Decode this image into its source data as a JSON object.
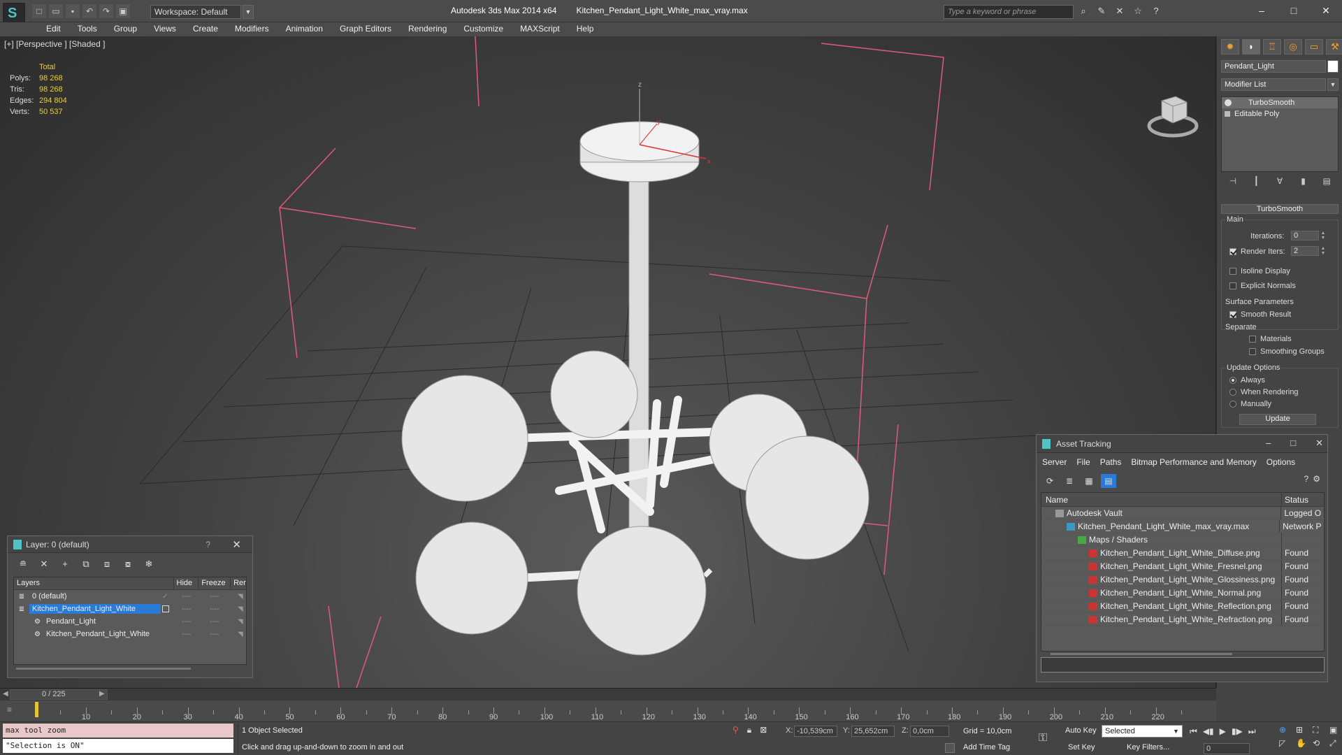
{
  "app": {
    "title_product": "Autodesk 3ds Max  2014 x64",
    "title_file": "Kitchen_Pendant_Light_White_max_vray.max",
    "workspace": "Workspace: Default",
    "search_placeholder": "Type a keyword or phrase",
    "colors": {
      "accent": "#2a7ad6",
      "stat_yellow": "#e6d23a",
      "playhead": "#e6c43a",
      "grid_pink": "#e05a7a"
    }
  },
  "menu": [
    "Edit",
    "Tools",
    "Group",
    "Views",
    "Create",
    "Modifiers",
    "Animation",
    "Graph Editors",
    "Rendering",
    "Customize",
    "MAXScript",
    "Help"
  ],
  "viewport": {
    "label": "[+] [Perspective ] [Shaded ]",
    "stats": {
      "total_label": "Total",
      "rows": [
        {
          "k": "Polys:",
          "v": "98 268"
        },
        {
          "k": "Tris:",
          "v": "98 268"
        },
        {
          "k": "Edges:",
          "v": "294 804"
        },
        {
          "k": "Verts:",
          "v": "50 537"
        }
      ]
    },
    "axis": {
      "x": "x",
      "y": "y",
      "z": "z"
    }
  },
  "command_panel": {
    "object_name": "Pendant_Light",
    "modifier_list": "Modifier List",
    "stack": [
      "TurboSmooth",
      "Editable Poly"
    ],
    "rollout_title": "TurboSmooth",
    "main_label": "Main",
    "iterations_label": "Iterations:",
    "iterations_value": "0",
    "render_iters_label": "Render Iters:",
    "render_iters_value": "2",
    "isoline": "Isoline Display",
    "explicit": "Explicit Normals",
    "surface_params": "Surface Parameters",
    "smooth_result": "Smooth Result",
    "separate": "Separate",
    "materials": "Materials",
    "smoothing_groups": "Smoothing Groups",
    "update_options": "Update Options",
    "always": "Always",
    "when_rendering": "When Rendering",
    "manually": "Manually",
    "update_btn": "Update"
  },
  "layer_window": {
    "title": "Layer: 0 (default)",
    "help": "?",
    "headers": {
      "layers": "Layers",
      "hide": "Hide",
      "freeze": "Freeze",
      "render": "Rend"
    },
    "rows": [
      {
        "name": "0 (default)",
        "level": 0
      },
      {
        "name": "Kitchen_Pendant_Light_White",
        "level": 0
      },
      {
        "name": "Pendant_Light",
        "level": 1
      },
      {
        "name": "Kitchen_Pendant_Light_White",
        "level": 1
      }
    ]
  },
  "asset_window": {
    "title": "Asset Tracking",
    "menu": [
      "Server",
      "File",
      "Paths",
      "Bitmap Performance and Memory",
      "Options"
    ],
    "headers": {
      "name": "Name",
      "status": "Status"
    },
    "rows": [
      {
        "name": "Autodesk Vault",
        "status": "Logged O",
        "icon": "vault",
        "indent": 20
      },
      {
        "name": "Kitchen_Pendant_Light_White_max_vray.max",
        "status": "Network P",
        "icon": "max",
        "indent": 36
      },
      {
        "name": "Maps / Shaders",
        "status": "",
        "icon": "maps",
        "indent": 52
      },
      {
        "name": "Kitchen_Pendant_Light_White_Diffuse.png",
        "status": "Found",
        "icon": "png",
        "indent": 68
      },
      {
        "name": "Kitchen_Pendant_Light_White_Fresnel.png",
        "status": "Found",
        "icon": "png",
        "indent": 68
      },
      {
        "name": "Kitchen_Pendant_Light_White_Glossiness.png",
        "status": "Found",
        "icon": "png",
        "indent": 68
      },
      {
        "name": "Kitchen_Pendant_Light_White_Normal.png",
        "status": "Found",
        "icon": "png",
        "indent": 68
      },
      {
        "name": "Kitchen_Pendant_Light_White_Reflection.png",
        "status": "Found",
        "icon": "png",
        "indent": 68
      },
      {
        "name": "Kitchen_Pendant_Light_White_Refraction.png",
        "status": "Found",
        "icon": "png",
        "indent": 68
      }
    ]
  },
  "timeline": {
    "frame_label": "0 / 225",
    "ticks": [
      10,
      20,
      30,
      40,
      50,
      60,
      70,
      80,
      90,
      100,
      110,
      120,
      130,
      140,
      150,
      160,
      170,
      180,
      190,
      200,
      210,
      220
    ]
  },
  "status": {
    "script_line1": "max tool zoom",
    "script_line2": "\"Selection is ON\"",
    "selected": "1 Object Selected",
    "prompt": "Click and drag up-and-down to zoom in and out",
    "x_label": "X:",
    "x_value": "-10,539cm",
    "y_label": "Y:",
    "y_value": "25,652cm",
    "z_label": "Z:",
    "z_value": "0,0cm",
    "grid": "Grid = 10,0cm",
    "add_time_tag": "Add Time Tag",
    "auto_key": "Auto Key",
    "set_key": "Set Key",
    "selected_dropdown": "Selected",
    "key_filters": "Key Filters...",
    "frame": "0"
  }
}
